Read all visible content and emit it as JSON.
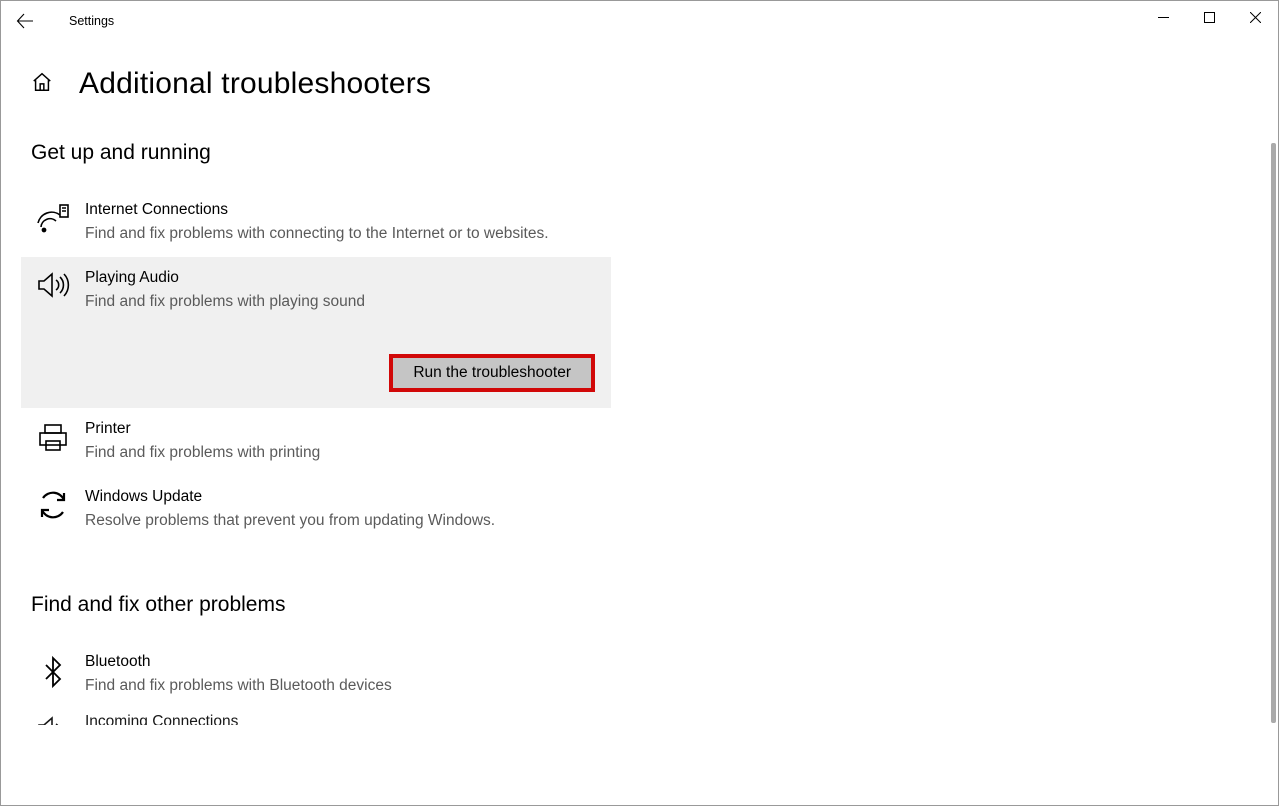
{
  "titlebar": {
    "app_name": "Settings"
  },
  "page": {
    "title": "Additional troubleshooters"
  },
  "sections": {
    "get_up": {
      "title": "Get up and running",
      "items": [
        {
          "title": "Internet Connections",
          "desc": "Find and fix problems with connecting to the Internet or to websites."
        },
        {
          "title": "Playing Audio",
          "desc": "Find and fix problems with playing sound",
          "run_label": "Run the troubleshooter"
        },
        {
          "title": "Printer",
          "desc": "Find and fix problems with printing"
        },
        {
          "title": "Windows Update",
          "desc": "Resolve problems that prevent you from updating Windows."
        }
      ]
    },
    "other": {
      "title": "Find and fix other problems",
      "items": [
        {
          "title": "Bluetooth",
          "desc": "Find and fix problems with Bluetooth devices"
        },
        {
          "title": "Incoming Connections",
          "desc": ""
        }
      ]
    }
  }
}
